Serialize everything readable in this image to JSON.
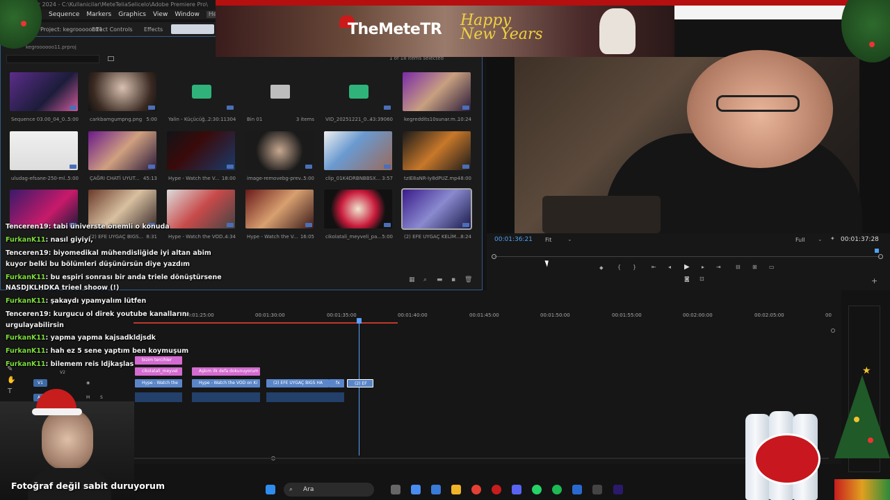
{
  "window": {
    "title": "Pr 2024 - C:\\Kullanicilar\\MeteTeliaSelicelo\\Adobe Premiere Pro\\"
  },
  "menu": [
    "Sequence",
    "Markers",
    "Graphics",
    "View",
    "Window",
    "Help"
  ],
  "panel_tabs": {
    "project": "Project: kegroooooo11",
    "effect_controls": "Effect Controls",
    "effects": "Effects"
  },
  "project_file": "kegroooooo11.prproj",
  "selection_info": "1 of 18 items selected",
  "banner": {
    "brand": "TheMeteTR",
    "greeting_line1": "Happy",
    "greeting_line2": "New Years"
  },
  "bin_items": [
    {
      "name": "Sequence 03.00_04_0...",
      "duration": "5:00"
    },
    {
      "name": "carkbamgumpng.png",
      "duration": "5:00"
    },
    {
      "name": "Yalin - Küçücüğ...",
      "duration": "2:30:11304"
    },
    {
      "name": "Bin 01",
      "duration": "3 items"
    },
    {
      "name": "VID_20251221_0...",
      "duration": "43:39060"
    },
    {
      "name": "kegreddits10sunar.m...",
      "duration": "10:24"
    },
    {
      "name": "uludag-efsane-250-ml...",
      "duration": "5:00"
    },
    {
      "name": "ÇAĞRI CHATİ UYUT...",
      "duration": "45:13"
    },
    {
      "name": "Hype - Watch the V...",
      "duration": "18:00"
    },
    {
      "name": "image-removebg-prev...",
      "duration": "5:00"
    },
    {
      "name": "clip_01K4DRBNBBSX...",
      "duration": "3:57"
    },
    {
      "name": "tzIE8aNR-Iy8dPUZ.mp4",
      "duration": "8:00"
    },
    {
      "name": "",
      "duration": ""
    },
    {
      "name": "(2) EFE UYGAÇ BIGS...",
      "duration": "8:31"
    },
    {
      "name": "Hype - Watch the VOD...",
      "duration": "4:34"
    },
    {
      "name": "Hype - Watch the V...",
      "duration": "16:05"
    },
    {
      "name": "cikolatali_meyveli_pa...",
      "duration": "5:00"
    },
    {
      "name": "(2) EFE UYGAÇ KELİM...",
      "duration": "8:24"
    }
  ],
  "program": {
    "timecode": "00:01:36:21",
    "zoom": "Fit",
    "quality": "Full",
    "duration": "00:01:37:28"
  },
  "ruler": [
    "00:01:25:00",
    "00:01:30:00",
    "00:01:35:00",
    "00:01:40:00",
    "00:01:45:00",
    "00:01:50:00",
    "00:01:55:00",
    "00:02:00:00",
    "00:02:05:00",
    "00"
  ],
  "tracks": {
    "v2": "V2",
    "v1": "V1",
    "a1": "A1",
    "m": "M",
    "s": "S"
  },
  "clips": {
    "title1": "bizim tercihler",
    "choco": "cikolatali_meyvel",
    "askim": "Aşkım ilk defa dokunuyorum",
    "hype1": "Hype - Watch the",
    "hype2": "Hype - Watch the VOD on Ki",
    "efe1": "(2) EFE UYGAÇ BIGS HA",
    "fx": "fx",
    "efe2": "(2) EF"
  },
  "chat": [
    {
      "user": "Tenceren19",
      "msg": ": tabi üniverste önemli o konuda"
    },
    {
      "user": "FurkanK11",
      "msg": ": nasıl giyiyi,"
    },
    {
      "user": "Tenceren19",
      "msg": ": biyomedikal mühendisliğide iyi altan abim"
    },
    {
      "user": "",
      "msg": "kuyor belki bu bölümleri düşünürsün diye yazdım"
    },
    {
      "user": "FurkanK11",
      "msg": ": bu espiri sonrası bir anda triele dönüştürsene"
    },
    {
      "user": "",
      "msg": "NASDJKLHDKA trieel shoow (!)"
    },
    {
      "user": "FurkanK11",
      "msg": ": şakaydı ypamyalım lütfen"
    },
    {
      "user": "Tenceren19",
      "msg": ": kurgucu ol direk youtube kanallarını"
    },
    {
      "user": "",
      "msg": "urgulayabilirsin"
    },
    {
      "user": "FurkanK11",
      "msg": ": yapma yapma kajsadkldjsdk"
    },
    {
      "user": "FurkanK11",
      "msg": ": hah ez 5 sene yaptım ben koymuşum"
    },
    {
      "user": "FurkanK11",
      "msg": ": bilemem reis ldjkaşlas"
    }
  ],
  "webcam_caption": "Fotoğraf değil sabit duruyorum",
  "taskbar": {
    "search_label": "Ara"
  },
  "colors": {
    "accent": "#4da3f5",
    "chat_user": "#7dde3c",
    "clip_pink": "#d46bd0",
    "clip_blue": "#5a86c9"
  }
}
